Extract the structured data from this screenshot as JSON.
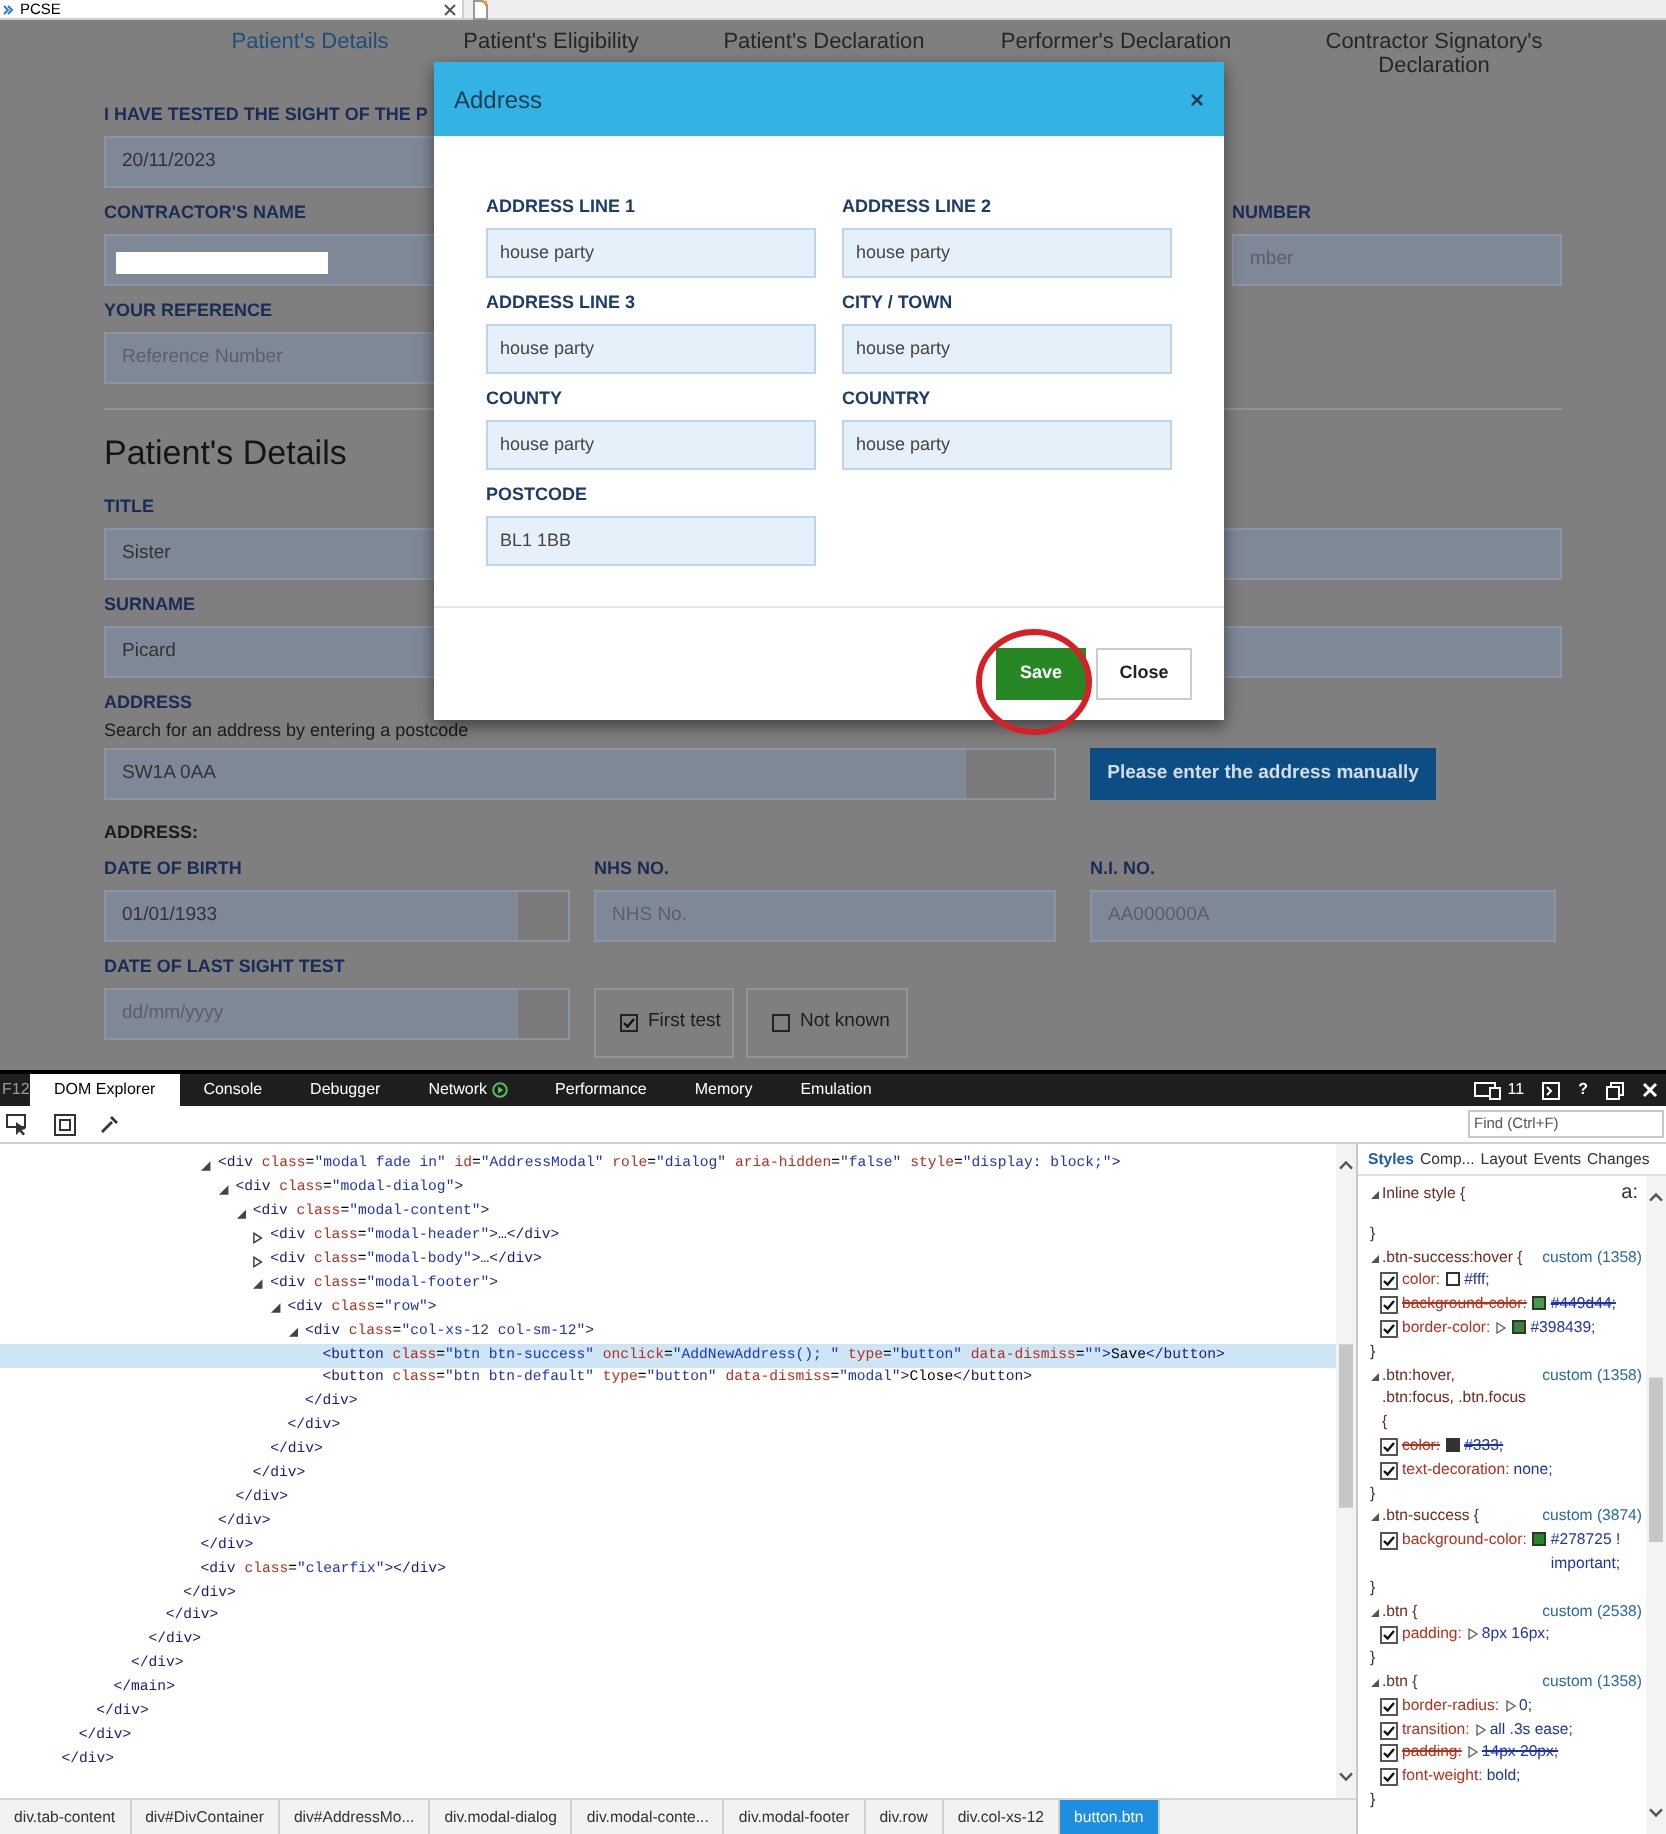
{
  "browser_tab": {
    "title": "PCSE"
  },
  "steps": [
    {
      "label": "Patient's Details",
      "selected": true
    },
    {
      "label": "Patient's Eligibility",
      "selected": false
    },
    {
      "label": "Patient's Declaration",
      "selected": false
    },
    {
      "label": "Performer's Declaration",
      "selected": false
    },
    {
      "label": "Contractor Signatory's Declaration",
      "selected": false
    }
  ],
  "form": {
    "sight_test": {
      "label": "I HAVE TESTED THE SIGHT OF THE P",
      "value": "20/11/2023"
    },
    "contractor_name": {
      "label": "CONTRACTOR'S NAME",
      "redacted": true
    },
    "number": {
      "label": "NUMBER",
      "placeholder": "mber"
    },
    "reference": {
      "label": "YOUR REFERENCE",
      "placeholder": "Reference Number"
    },
    "section_title": "Patient's Details",
    "title": {
      "label": "TITLE",
      "value": "Sister"
    },
    "surname": {
      "label": "SURNAME",
      "value": "Picard"
    },
    "address": {
      "label": "ADDRESS",
      "hint": "Search for an address by entering a postcode",
      "value": "SW1A 0AA",
      "button": "Please enter the address manually"
    },
    "address_result_label": "ADDRESS:",
    "identity_fields": [
      {
        "kind": "date",
        "label": "DATE OF BIRTH",
        "value": "01/01/1933"
      },
      {
        "kind": "text",
        "label": "NHS NO.",
        "placeholder": "NHS No."
      },
      {
        "kind": "text",
        "label": "N.I. NO.",
        "placeholder": "AA000000A"
      }
    ],
    "last_sight_test": {
      "label": "DATE OF LAST SIGHT TEST",
      "placeholder": "dd/mm/yyyy",
      "options": [
        {
          "label": "First test",
          "checked": true
        },
        {
          "label": "Not known",
          "checked": false
        }
      ]
    }
  },
  "modal": {
    "title": "Address",
    "close_glyph": "×",
    "fields": [
      {
        "label": "ADDRESS LINE 1",
        "value": "house party"
      },
      {
        "label": "ADDRESS LINE 2",
        "value": "house party"
      },
      {
        "label": "ADDRESS LINE 3",
        "value": "house party"
      },
      {
        "label": "CITY / TOWN",
        "value": "house party"
      },
      {
        "label": "COUNTY",
        "value": "house party"
      },
      {
        "label": "COUNTRY",
        "value": "house party"
      },
      {
        "label": "POSTCODE",
        "value": "BL1 1BB"
      }
    ],
    "save": "Save",
    "close": "Close"
  },
  "devtools": {
    "f12": "F12",
    "tabs": [
      {
        "kind": "plain",
        "label": "DOM Explorer",
        "selected": true
      },
      {
        "kind": "plain",
        "label": "Console",
        "selected": false
      },
      {
        "kind": "plain",
        "label": "Debugger",
        "selected": false
      },
      {
        "kind": "network",
        "label": "Network",
        "selected": false
      },
      {
        "kind": "plain",
        "label": "Performance",
        "selected": false
      },
      {
        "kind": "plain",
        "label": "Memory",
        "selected": false
      },
      {
        "kind": "plain",
        "label": "Emulation",
        "selected": false
      }
    ],
    "document_mode": "11",
    "help": "?",
    "find_placeholder": "Find (Ctrl+F)",
    "dom_tree": [
      {
        "close": "</div>",
        "selected": false,
        "children": [
          {
            "close": "</div>",
            "selected": false,
            "children": [
              {
                "close": "</div>",
                "selected": false,
                "children": [
                  {
                    "close": "</main>",
                    "selected": false,
                    "children": [
                      {
                        "close": "</div>",
                        "selected": false,
                        "children": [
                          {
                            "close": "</div>",
                            "selected": false,
                            "children": [
                              {
                                "close": "</div>",
                                "selected": false,
                                "children": [
                                  {
                                    "close": "</div>",
                                    "selected": false,
                                    "children": [
                                      {
                                        "close": "</div>",
                                        "selected": false,
                                        "children": [
                                          {
                                            "open": "<div class=\"modal fade in\" id=\"AddressModal\" role=\"dialog\" aria-hidden=\"false\" style=\"display: block;\">",
                                            "close": "</div>",
                                            "expanded": true,
                                            "selected": false,
                                            "children": [
                                              {
                                                "open": "<div class=\"modal-dialog\">",
                                                "close": "</div>",
                                                "expanded": true,
                                                "selected": false,
                                                "children": [
                                                  {
                                                    "open": "<div class=\"modal-content\">",
                                                    "close": "</div>",
                                                    "expanded": true,
                                                    "selected": false,
                                                    "children": [
                                                      {
                                                        "open": "<div class=\"modal-header\">…</div>",
                                                        "expanded": false,
                                                        "selected": false
                                                      },
                                                      {
                                                        "open": "<div class=\"modal-body\">…</div>",
                                                        "expanded": false,
                                                        "selected": false
                                                      },
                                                      {
                                                        "open": "<div class=\"modal-footer\">",
                                                        "close": "</div>",
                                                        "expanded": true,
                                                        "selected": false,
                                                        "children": [
                                                          {
                                                            "open": "<div class=\"row\">",
                                                            "close": "</div>",
                                                            "expanded": true,
                                                            "selected": false,
                                                            "children": [
                                                              {
                                                                "open": "<div class=\"col-xs-12 col-sm-12\">",
                                                                "close": "</div>",
                                                                "expanded": true,
                                                                "selected": false,
                                                                "children": [
                                                                  {
                                                                    "open": "<button class=\"btn btn-success\" onclick=\"AddNewAddress(); \" type=\"button\" data-dismiss=\"\">Save</button>",
                                                                    "selected": true
                                                                  },
                                                                  {
                                                                    "open": "<button class=\"btn btn-default\" type=\"button\" data-dismiss=\"modal\">Close</button>",
                                                                    "selected": false
                                                                  }
                                                                ]
                                                              }
                                                            ]
                                                          }
                                                        ]
                                                      }
                                                    ]
                                                  }
                                                ]
                                              }
                                            ]
                                          }
                                        ]
                                      },
                                      {
                                        "open": "<div class=\"clearfix\"></div>",
                                        "selected": false
                                      }
                                    ]
                                  }
                                ]
                              }
                            ]
                          }
                        ]
                      }
                    ]
                  }
                ]
              }
            ]
          }
        ]
      }
    ],
    "breadcrumbs": [
      {
        "label": "div.tab-content",
        "selected": false
      },
      {
        "label": "div#DivContainer",
        "selected": false
      },
      {
        "label": "div#AddressMo...",
        "selected": false
      },
      {
        "label": "div.modal-dialog",
        "selected": false
      },
      {
        "label": "div.modal-conte...",
        "selected": false
      },
      {
        "label": "div.modal-footer",
        "selected": false
      },
      {
        "label": "div.row",
        "selected": false
      },
      {
        "label": "div.col-xs-12",
        "selected": false
      },
      {
        "label": "button.btn",
        "selected": true
      }
    ],
    "style_tabs": [
      {
        "label": "Styles",
        "selected": true
      },
      {
        "label": "Comp...",
        "selected": false
      },
      {
        "label": "Layout",
        "selected": false
      },
      {
        "label": "Events",
        "selected": false
      },
      {
        "label": "Changes",
        "selected": false
      }
    ],
    "state_toggle": "a:",
    "rules": [
      {
        "selector": "Inline style {",
        "close": "}"
      },
      {
        "selector": ".btn-success:hover {",
        "source": "custom (1358)",
        "close": "}",
        "declarations": [
          {
            "property": "color:",
            "value": "#fff;",
            "color": "#ffffff",
            "expandable": false,
            "overridden": false,
            "checked": true
          },
          {
            "property": "background-color:",
            "value": "#449d44;",
            "color": "#449d44",
            "expandable": false,
            "overridden": true,
            "checked": true
          },
          {
            "property": "border-color:",
            "value": "#398439;",
            "color": "#398439",
            "expandable": true,
            "overridden": false,
            "checked": true
          }
        ]
      },
      {
        "selector": ".btn:hover, .btn:focus, .btn.focus {",
        "source": "custom (1358)",
        "close": "}",
        "declarations": [
          {
            "property": "color:",
            "value": "#333;",
            "color": "#333333",
            "expandable": false,
            "overridden": true,
            "checked": true
          },
          {
            "property": "text-decoration:",
            "value": "none;",
            "expandable": false,
            "overridden": false,
            "checked": true
          }
        ]
      },
      {
        "selector": ".btn-success {",
        "source": "custom (3874)",
        "close": "}",
        "declarations": [
          {
            "property": "background-color:",
            "value": "#278725 ! important;",
            "color": "#278725",
            "expandable": false,
            "overridden": false,
            "checked": true
          }
        ]
      },
      {
        "selector": ".btn {",
        "source": "custom (2538)",
        "close": "}",
        "declarations": [
          {
            "property": "padding:",
            "value": "8px 16px;",
            "expandable": true,
            "overridden": false,
            "checked": true
          }
        ]
      },
      {
        "selector": ".btn {",
        "source": "custom (1358)",
        "close": "}",
        "declarations": [
          {
            "property": "border-radius:",
            "value": "0;",
            "expandable": true,
            "overridden": false,
            "checked": true
          },
          {
            "property": "transition:",
            "value": "all .3s ease;",
            "expandable": true,
            "overridden": false,
            "checked": true
          },
          {
            "property": "padding:",
            "value": "14px 20px;",
            "expandable": true,
            "overridden": true,
            "checked": true
          },
          {
            "property": "font-weight:",
            "value": "bold;",
            "expandable": false,
            "overridden": false,
            "checked": true
          }
        ]
      }
    ]
  }
}
